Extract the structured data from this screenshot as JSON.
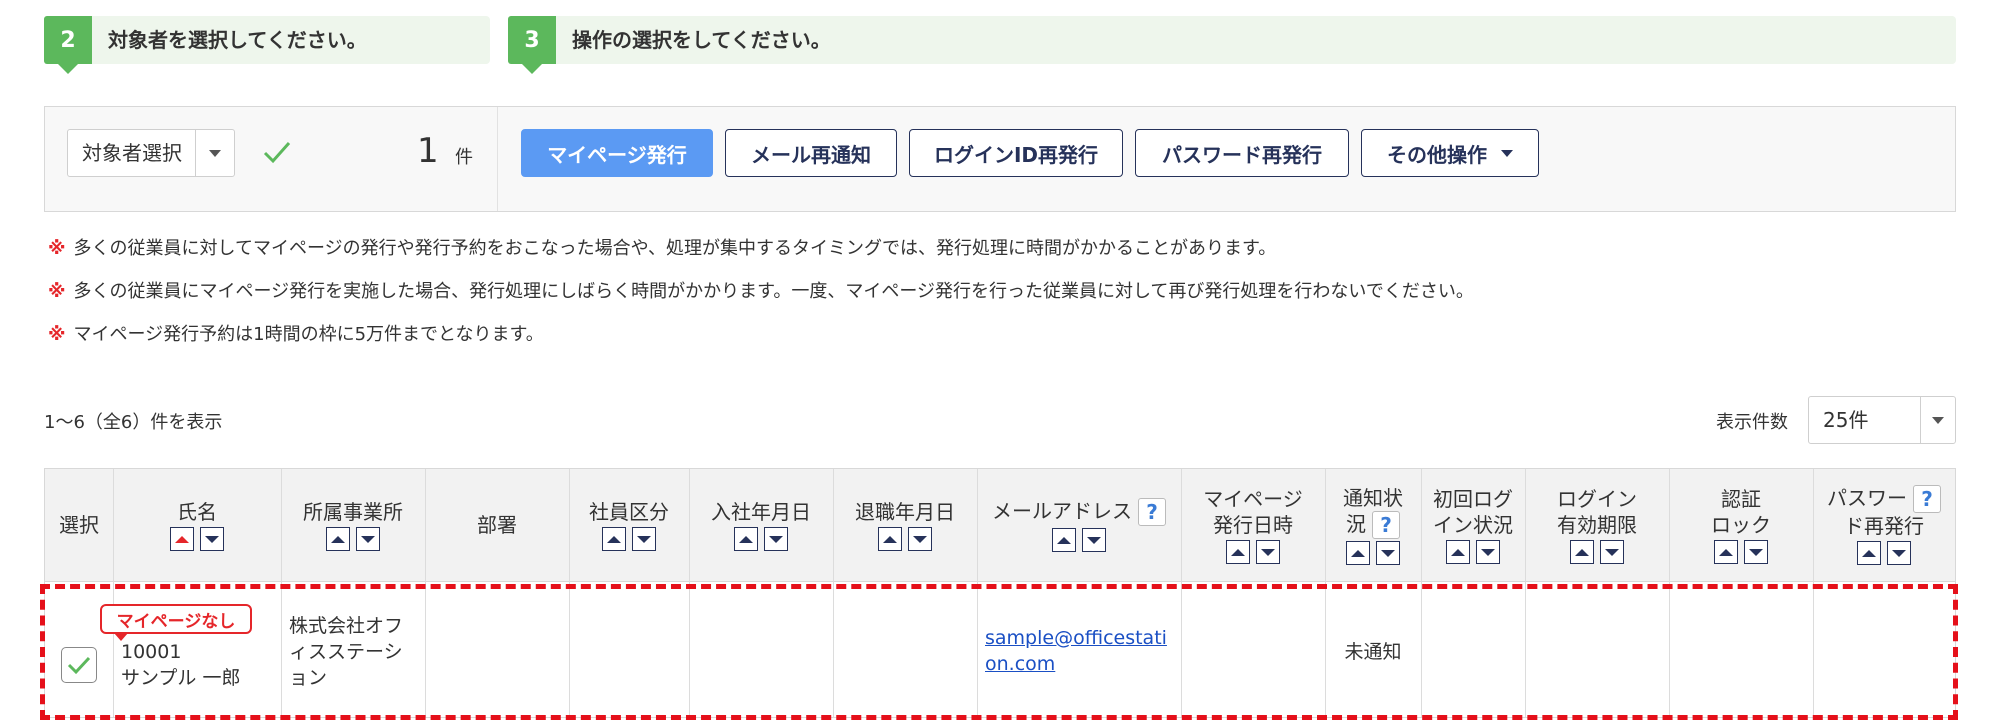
{
  "steps": [
    {
      "number": "2",
      "text": "対象者を選択してください。"
    },
    {
      "number": "3",
      "text": "操作の選択をしてください。"
    }
  ],
  "panel": {
    "target_select_label": "対象者選択",
    "count": "1",
    "count_unit": "件",
    "buttons": {
      "mypage_issue": "マイページ発行",
      "mail_renotify": "メール再通知",
      "login_id_reissue": "ログインID再発行",
      "password_reissue": "パスワード再発行",
      "other_ops": "その他操作"
    }
  },
  "notes": {
    "mark": "※",
    "items": [
      "多くの従業員に対してマイページの発行や発行予約をおこなった場合や、処理が集中するタイミングでは、発行処理に時間がかかることがあります。",
      "多くの従業員にマイページ発行を実施した場合、発行処理にしばらく時間がかかります。一度、マイページ発行を行った従業員に対して再び発行処理を行わないでください。",
      "マイページ発行予約は1時間の枠に5万件までとなります。"
    ]
  },
  "list": {
    "showing": "1〜6（全6）件を表示",
    "per_page_label": "表示件数",
    "per_page_value": "25件"
  },
  "table": {
    "headers": {
      "select": "選択",
      "name": "氏名",
      "office": "所属事業所",
      "department": "部署",
      "employee_type": "社員区分",
      "hire_date": "入社年月日",
      "leave_date": "退職年月日",
      "email": "メールアドレス",
      "mypage_issue_date_1": "マイページ",
      "mypage_issue_date_2": "発行日時",
      "notify_status_1": "通知状",
      "notify_status_2": "況",
      "first_login_1": "初回ログ",
      "first_login_2": "イン状況",
      "login_expiry_1": "ログイン",
      "login_expiry_2": "有効期限",
      "auth_lock_1": "認証",
      "auth_lock_2": "ロック",
      "pw_reissue_1": "パスワー",
      "pw_reissue_2": "ド再発行",
      "help": "?"
    },
    "row": {
      "badge": "マイページなし",
      "employee_no": "10001",
      "name": "サンプル 一郎",
      "office_1": "株式会社オフ",
      "office_2": "ィスステーシ",
      "office_3": "ョン",
      "email_1": "sample@officestati",
      "email_2": "on.com",
      "notify_status": "未通知"
    }
  },
  "colors": {
    "accent_green": "#5cb85c",
    "primary_blue": "#5b9af3",
    "navy": "#26325a",
    "alert_red": "#e5262a"
  }
}
